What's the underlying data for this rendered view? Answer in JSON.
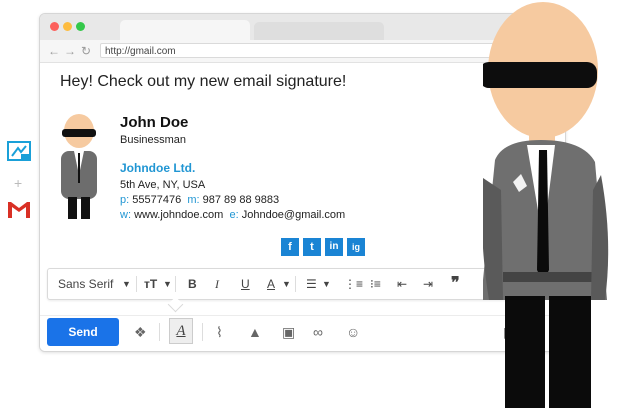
{
  "browser": {
    "url": "http://gmail.com",
    "traffic_lights": [
      "#fc605c",
      "#fdbc40",
      "#34c84a"
    ]
  },
  "email": {
    "heading": "Hey! Check out my new email signature!",
    "signature": {
      "name": "John Doe",
      "title": "Businessman",
      "company": "Johndoe Ltd.",
      "address": "5th Ave, NY, USA",
      "phone_label": "p:",
      "phone": "55577476",
      "mobile_label": "m:",
      "mobile": "987 89 88 9883",
      "website_label": "w:",
      "website": "www.johndoe.com",
      "email_label": "e:",
      "email": "Johndoe@gmail.com",
      "social": [
        "f",
        "t",
        "in",
        "ig"
      ]
    }
  },
  "toolbar": {
    "font": "Sans Serif",
    "icons": [
      "text-size-icon",
      "bold-icon",
      "italic-icon",
      "underline-icon",
      "text-color-icon",
      "align-icon",
      "numbered-list-icon",
      "bulleted-list-icon",
      "indent-less-icon",
      "indent-more-icon",
      "quote-icon",
      "remove-formatting-icon"
    ]
  },
  "compose": {
    "send_label": "Send"
  },
  "colors": {
    "accent": "#1a73e8",
    "link": "#2196d3",
    "social": "#1a84d4"
  }
}
